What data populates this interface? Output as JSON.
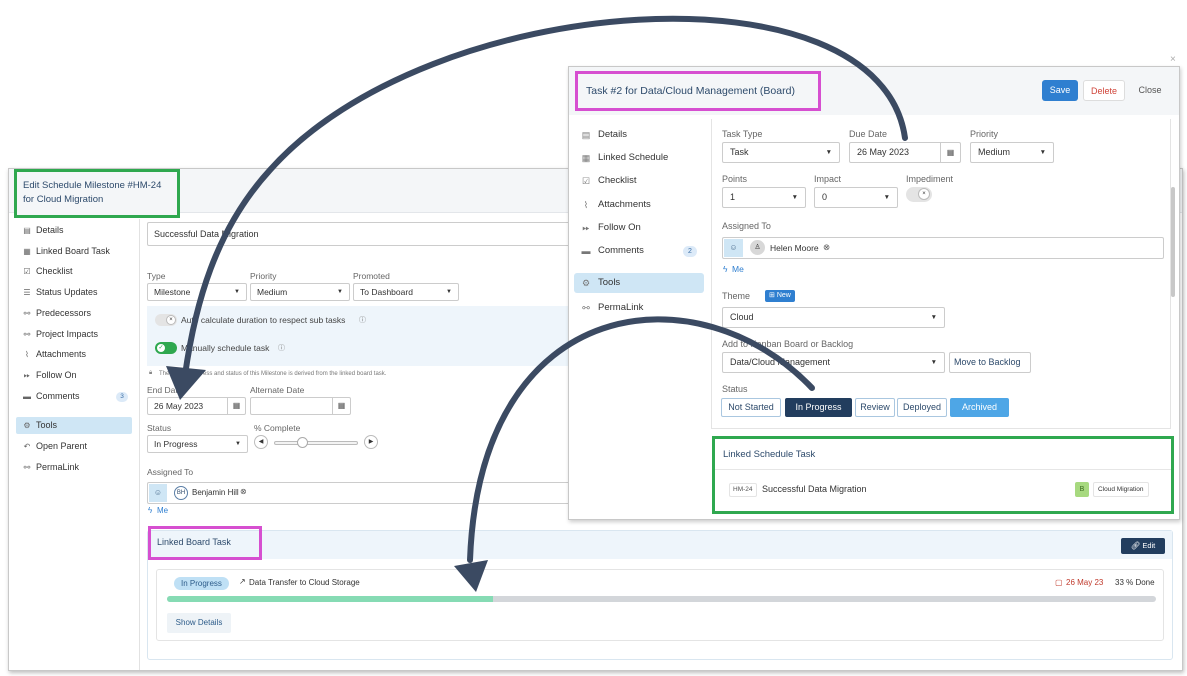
{
  "back": {
    "title": "Edit Schedule Milestone #HM-24 for Cloud Migration",
    "sidebar": [
      {
        "label": "Details",
        "icon": "document-icon"
      },
      {
        "label": "Linked Board Task",
        "icon": "calendar-icon"
      },
      {
        "label": "Checklist",
        "icon": "checkbox-icon"
      },
      {
        "label": "Status Updates",
        "icon": "list-icon"
      },
      {
        "label": "Predecessors",
        "icon": "link-icon"
      },
      {
        "label": "Project Impacts",
        "icon": "link-icon"
      },
      {
        "label": "Attachments",
        "icon": "paperclip-icon"
      },
      {
        "label": "Follow On",
        "icon": "fast-forward-icon"
      },
      {
        "label": "Comments",
        "icon": "comment-icon",
        "badge": "3"
      },
      {
        "label": "Tools",
        "icon": "gear-icon",
        "active": true
      },
      {
        "label": "Open Parent",
        "icon": "reply-icon"
      },
      {
        "label": "PermaLink",
        "icon": "link-icon"
      }
    ],
    "name_value": "Successful Data Migration",
    "type_label": "Type",
    "type_value": "Milestone",
    "priority_label": "Priority",
    "priority_value": "Medium",
    "promoted_label": "Promoted",
    "promoted_value": "To Dashboard",
    "auto_calc_text": "Auto calculate duration to respect sub tasks",
    "manual_text": "Manually schedule task",
    "derived_note": "The dates, progress and status of this Milestone is derived from the linked board task.",
    "end_date_label": "End Date",
    "end_date_value": "26 May 2023",
    "alt_date_label": "Alternate Date",
    "alt_date_value": "",
    "status_label": "Status",
    "status_value": "In Progress",
    "complete_label": "% Complete",
    "assigned_label": "Assigned To",
    "assignee_initials": "BH",
    "assignee_name": "Benjamin Hill",
    "me_link": "Me",
    "linked_board": {
      "title": "Linked Board Task",
      "edit_label": "Edit",
      "status_pill": "In Progress",
      "task_name": "Data Transfer to Cloud Storage",
      "date": "26 May 23",
      "done": "33 % Done",
      "progress": 0.33,
      "show_details": "Show Details"
    }
  },
  "front": {
    "title": "Task #2 for Data/Cloud Management (Board)",
    "save_label": "Save",
    "delete_label": "Delete",
    "close_label": "Close",
    "sidebar": [
      {
        "label": "Details",
        "icon": "document-icon"
      },
      {
        "label": "Linked Schedule",
        "icon": "calendar-icon"
      },
      {
        "label": "Checklist",
        "icon": "checkbox-icon"
      },
      {
        "label": "Attachments",
        "icon": "paperclip-icon"
      },
      {
        "label": "Follow On",
        "icon": "fast-forward-icon"
      },
      {
        "label": "Comments",
        "icon": "comment-icon",
        "badge": "2"
      },
      {
        "label": "Tools",
        "icon": "gear-icon",
        "active": true
      },
      {
        "label": "PermaLink",
        "icon": "link-icon"
      }
    ],
    "task_type_label": "Task Type",
    "task_type_value": "Task",
    "due_date_label": "Due Date",
    "due_date_value": "26 May 2023",
    "priority_label": "Priority",
    "priority_value": "Medium",
    "points_label": "Points",
    "points_value": "1",
    "impact_label": "Impact",
    "impact_value": "0",
    "impediment_label": "Impediment",
    "assigned_label": "Assigned To",
    "assignee_name": "Helen Moore",
    "me_link": "Me",
    "theme_label": "Theme",
    "new_badge": "New",
    "theme_value": "Cloud",
    "board_label": "Add to Kanban Board or Backlog",
    "board_value": "Data/Cloud Management",
    "move_backlog_label": "Move to Backlog",
    "status_label": "Status",
    "statuses": [
      "Not Started",
      "In Progress",
      "Review",
      "Deployed",
      "Archived"
    ],
    "linked_schedule": {
      "title": "Linked Schedule Task",
      "code": "HM-24",
      "name": "Successful Data Migration",
      "badge_letter": "B",
      "project": "Cloud Migration"
    }
  },
  "colors": {
    "green_highlight": "#2fa84f",
    "magenta_highlight": "#d64fd0",
    "arrow": "#3b4a62",
    "primary": "#2f7fd0",
    "navy": "#223d5e"
  }
}
